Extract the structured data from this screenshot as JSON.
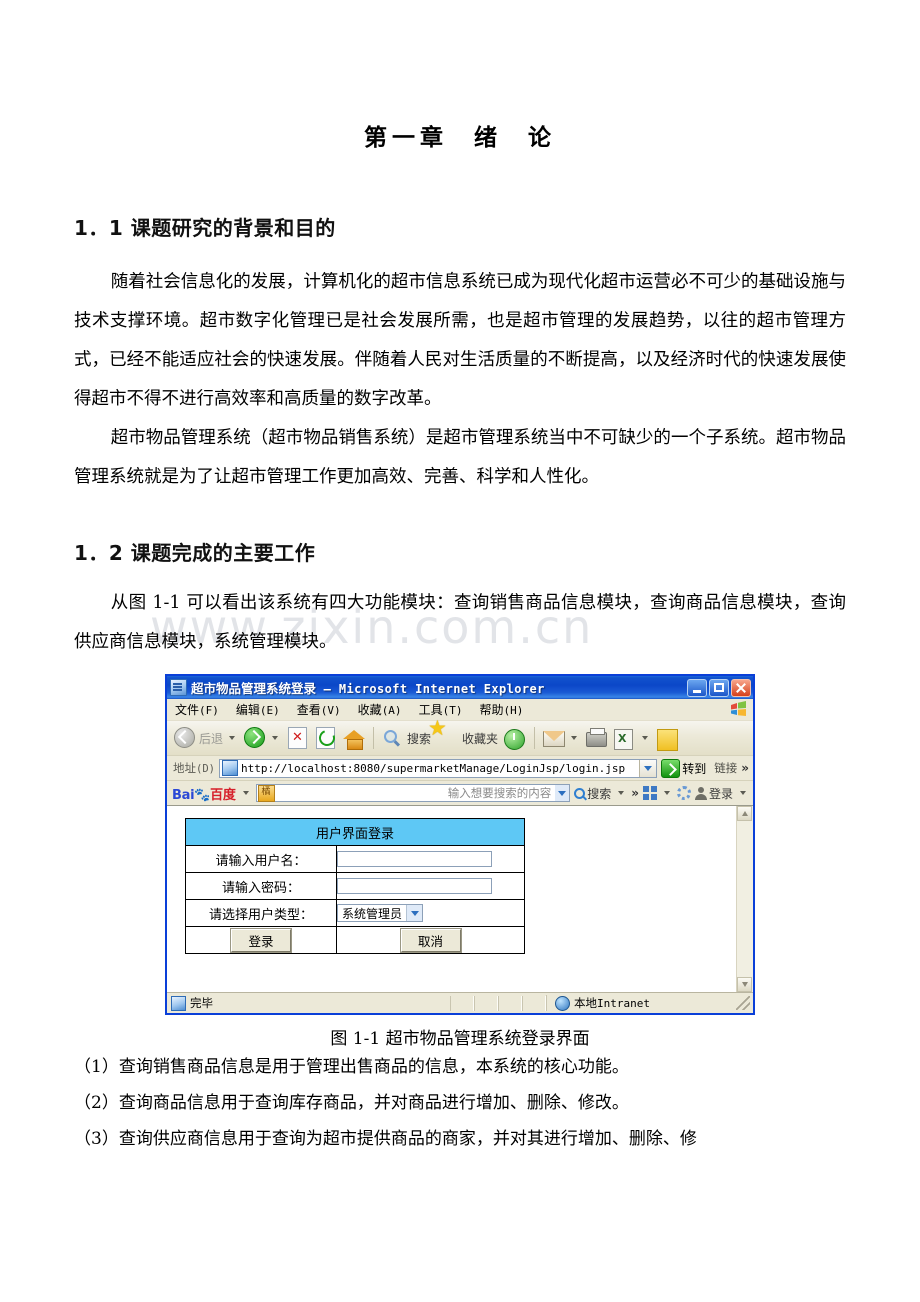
{
  "document": {
    "chapter_title_a": "第一章",
    "chapter_title_b": "绪",
    "chapter_title_c": "论",
    "section_1_heading": "1．1 课题研究的背景和目的",
    "section_1_para_1": "随着社会信息化的发展，计算机化的超市信息系统已成为现代化超市运营必不可少的基础设施与技术支撑环境。超市数字化管理已是社会发展所需，也是超市管理的发展趋势，以往的超市管理方式，已经不能适应社会的快速发展。伴随着人民对生活质量的不断提高，以及经济时代的快速发展使得超市不得不进行高效率和高质量的数字改革。",
    "section_1_para_2": "超市物品管理系统（超市物品销售系统）是超市管理系统当中不可缺少的一个子系统。超市物品管理系统就是为了让超市管理工作更加高效、完善、科学和人性化。",
    "section_2_heading": "1．2 课题完成的主要工作",
    "section_2_para_1": "从图 1-1 可以看出该系统有四大功能模块：查询销售商品信息模块，查询商品信息模块，查询供应商信息模块，系统管理模块。",
    "figure_caption": "图 1-1 超市物品管理系统登录界面",
    "list_items": [
      "（1）查询销售商品信息是用于管理出售商品的信息，本系统的核心功能。",
      "（2）查询商品信息用于查询库存商品，并对商品进行增加、删除、修改。",
      "（3）查询供应商信息用于查询为超市提供商品的商家，并对其进行增加、删除、修"
    ],
    "watermark": "www.zixin.com.cn"
  },
  "browser": {
    "title_cn": "超市物品管理系统登录",
    "title_dash": " – ",
    "title_en": "Microsoft Internet Explorer",
    "window_controls": {
      "minimize": "minimize-button",
      "maximize": "maximize-button",
      "close": "close-button"
    },
    "menu": [
      {
        "label": "文件",
        "key": "(F)"
      },
      {
        "label": "编辑",
        "key": "(E)"
      },
      {
        "label": "查看",
        "key": "(V)"
      },
      {
        "label": "收藏",
        "key": "(A)"
      },
      {
        "label": "工具",
        "key": "(T)"
      },
      {
        "label": "帮助",
        "key": "(H)"
      }
    ],
    "toolbar": {
      "back_label": "后退",
      "search_label": "搜索",
      "favorites_label": "收藏夹"
    },
    "address": {
      "label": "地址",
      "label_key": "(D)",
      "url": "http://localhost:8080/supermarketManage/LoginJsp/login.jsp",
      "go_label": "转到",
      "links_label": "链接",
      "overflow": "»"
    },
    "baidu": {
      "logo_latin": "Bai",
      "logo_cn": "百度",
      "placeholder": "输入想要搜索的内容",
      "search_label": "搜索",
      "overflow": "»",
      "login_label": "登录"
    },
    "statusbar": {
      "status": "完毕",
      "zone_cn": "本地",
      "zone_en": "Intranet"
    },
    "colors": {
      "titlebar_blue": "#0b47c8",
      "window_border": "#0a3fd8",
      "chrome": "#ece9d8",
      "table_header": "#5ec8f5"
    }
  },
  "login_form": {
    "header": "用户界面登录",
    "rows": [
      {
        "label": "请输入用户名：",
        "value": "",
        "type": "text"
      },
      {
        "label": "请输入密码：",
        "value": "",
        "type": "password"
      }
    ],
    "usertype_label": "请选择用户类型：",
    "usertype_value": "系统管理员",
    "submit_label": "登录",
    "cancel_label": "取消"
  }
}
